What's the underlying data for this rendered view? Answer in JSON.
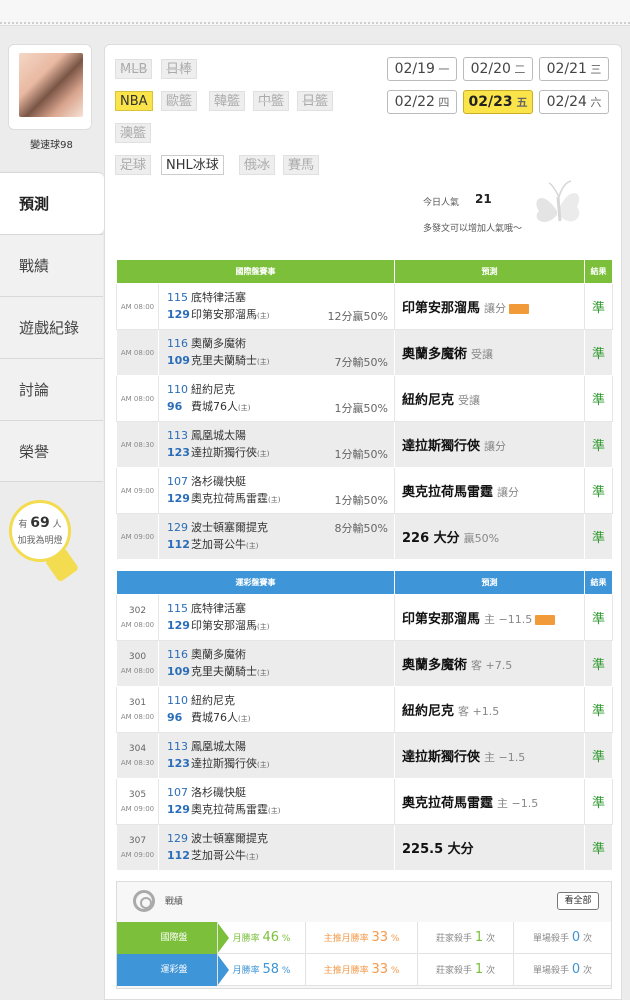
{
  "user": {
    "name": "變速球98"
  },
  "nav": [
    "預測",
    "戰績",
    "遊戲紀錄",
    "討論",
    "榮譽"
  ],
  "fans": {
    "prefix": "有",
    "count": "69",
    "suffix": "人",
    "caption": "加我為明燈"
  },
  "sports": [
    {
      "label": "MLB",
      "state": "off"
    },
    {
      "label": "日棒",
      "state": "off"
    },
    {
      "label": "NBA",
      "state": "selected"
    },
    {
      "label": "歐籃",
      "state": "off"
    },
    {
      "label": "韓籃",
      "state": "off"
    },
    {
      "label": "中籃",
      "state": "off"
    },
    {
      "label": "日籃",
      "state": "off"
    },
    {
      "label": "澳籃",
      "state": "off"
    },
    {
      "label": "足球",
      "state": "off"
    },
    {
      "label": "NHL冰球",
      "state": "on"
    },
    {
      "label": "俄冰",
      "state": "off"
    },
    {
      "label": "賽馬",
      "state": "off"
    }
  ],
  "dates": [
    {
      "md": "02/19",
      "wd": "一"
    },
    {
      "md": "02/20",
      "wd": "二"
    },
    {
      "md": "02/21",
      "wd": "三"
    },
    {
      "md": "02/22",
      "wd": "四"
    },
    {
      "md": "02/23",
      "wd": "五",
      "selected": true
    },
    {
      "md": "02/24",
      "wd": "六"
    }
  ],
  "popularity": {
    "label": "今日人氣",
    "value": "21",
    "hint": "多發文可以增加人氣哦～"
  },
  "intl": {
    "headers": [
      "國際盤賽事",
      "預測",
      "結果"
    ],
    "rows": [
      {
        "time": "AM 08:00",
        "a_num": "115",
        "a_name": "底特律活塞",
        "h_num": "129",
        "h_name": "印第安那溜馬",
        "spread": "12分贏50%",
        "spread_row": "bottom",
        "pick": "印第安那溜馬",
        "pick_sub": "讓分",
        "icon": true,
        "result": "準"
      },
      {
        "time": "AM 08:00",
        "a_num": "116",
        "a_name": "奧蘭多魔術",
        "h_num": "109",
        "h_name": "克里夫蘭騎士",
        "spread": "7分輸50%",
        "spread_row": "bottom",
        "pick": "奧蘭多魔術",
        "pick_sub": "受讓",
        "icon": false,
        "result": "準"
      },
      {
        "time": "AM 08:00",
        "a_num": "110",
        "a_name": "紐約尼克",
        "h_num": "96",
        "h_name": "費城76人",
        "spread": "1分贏50%",
        "spread_row": "bottom",
        "pick": "紐約尼克",
        "pick_sub": "受讓",
        "icon": false,
        "result": "準"
      },
      {
        "time": "AM 08:30",
        "a_num": "113",
        "a_name": "鳳凰城太陽",
        "h_num": "123",
        "h_name": "達拉斯獨行俠",
        "spread": "1分輸50%",
        "spread_row": "bottom",
        "pick": "達拉斯獨行俠",
        "pick_sub": "讓分",
        "icon": false,
        "result": "準"
      },
      {
        "time": "AM 09:00",
        "a_num": "107",
        "a_name": "洛杉磯快艇",
        "h_num": "129",
        "h_name": "奧克拉荷馬雷霆",
        "spread": "1分輸50%",
        "spread_row": "bottom",
        "pick": "奧克拉荷馬雷霆",
        "pick_sub": "讓分",
        "icon": false,
        "result": "準"
      },
      {
        "time": "AM 09:00",
        "a_num": "129",
        "a_name": "波士頓塞爾提克",
        "h_num": "112",
        "h_name": "芝加哥公牛",
        "spread": "8分輸50%",
        "spread_row": "top",
        "pick": "226 大分",
        "pick_sub": "贏50%",
        "icon": false,
        "result": "準"
      }
    ]
  },
  "lottery": {
    "headers": [
      "運彩盤賽事",
      "預測",
      "結果"
    ],
    "rows": [
      {
        "gid": "302",
        "time": "AM 08:00",
        "a_num": "115",
        "a_name": "底特律活塞",
        "h_num": "129",
        "h_name": "印第安那溜馬",
        "pick": "印第安那溜馬",
        "pick_sub": "主 −11.5",
        "icon": true,
        "result": "準"
      },
      {
        "gid": "300",
        "time": "AM 08:00",
        "a_num": "116",
        "a_name": "奧蘭多魔術",
        "h_num": "109",
        "h_name": "克里夫蘭騎士",
        "pick": "奧蘭多魔術",
        "pick_sub": "客 +7.5",
        "icon": false,
        "result": "準"
      },
      {
        "gid": "301",
        "time": "AM 08:00",
        "a_num": "110",
        "a_name": "紐約尼克",
        "h_num": "96",
        "h_name": "費城76人",
        "pick": "紐約尼克",
        "pick_sub": "客 +1.5",
        "icon": false,
        "result": "準"
      },
      {
        "gid": "304",
        "time": "AM 08:30",
        "a_num": "113",
        "a_name": "鳳凰城太陽",
        "h_num": "123",
        "h_name": "達拉斯獨行俠",
        "pick": "達拉斯獨行俠",
        "pick_sub": "主 −1.5",
        "icon": false,
        "result": "準"
      },
      {
        "gid": "305",
        "time": "AM 09:00",
        "a_num": "107",
        "a_name": "洛杉磯快艇",
        "h_num": "129",
        "h_name": "奧克拉荷馬雷霆",
        "pick": "奧克拉荷馬雷霆",
        "pick_sub": "主 −1.5",
        "icon": false,
        "result": "準"
      },
      {
        "gid": "307",
        "time": "AM 09:00",
        "a_num": "129",
        "a_name": "波士頓塞爾提克",
        "h_num": "112",
        "h_name": "芝加哥公牛",
        "pick": "225.5 大分",
        "pick_sub": "",
        "icon": false,
        "result": "準"
      }
    ]
  },
  "home_mark": "(主)",
  "stats": {
    "title": "戰績",
    "view_all": "看全部",
    "rows": [
      {
        "cat": "國際盤",
        "monthly_label": "月勝率",
        "monthly": "46",
        "home_label": "主推月勝率",
        "home": "33",
        "killer_label": "莊家殺手",
        "killer": "1",
        "single_label": "單場殺手",
        "single": "0",
        "unit_pct": "%",
        "unit_times": "次"
      },
      {
        "cat": "運彩盤",
        "monthly_label": "月勝率",
        "monthly": "58",
        "home_label": "主推月勝率",
        "home": "33",
        "killer_label": "莊家殺手",
        "killer": "1",
        "single_label": "單場殺手",
        "single": "0",
        "unit_pct": "%",
        "unit_times": "次"
      }
    ]
  },
  "colors": {
    "green": "#7bbf3a",
    "blue": "#3e95d8",
    "yellow": "#fbe44a",
    "orange": "#f39a4a"
  }
}
